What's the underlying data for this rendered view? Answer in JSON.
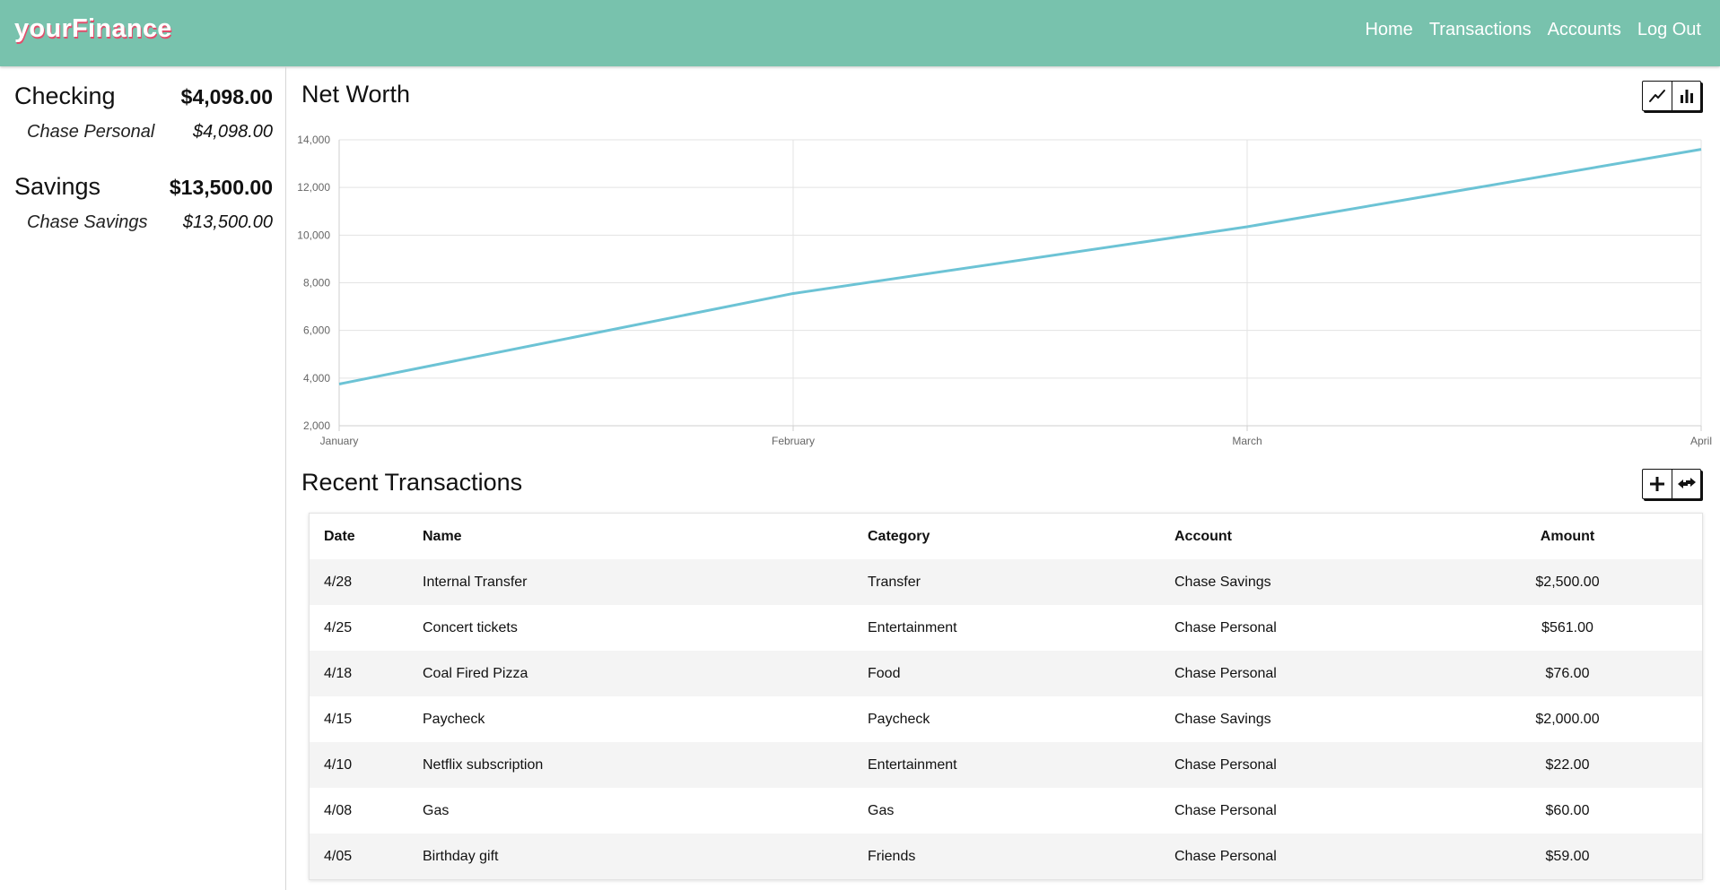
{
  "app": {
    "brand": "yourFinance"
  },
  "nav": {
    "items": [
      "Home",
      "Transactions",
      "Accounts",
      "Log Out"
    ]
  },
  "sidebar": {
    "groups": [
      {
        "name": "Checking",
        "total": "$4,098.00",
        "accounts": [
          {
            "name": "Chase Personal",
            "balance": "$4,098.00"
          }
        ]
      },
      {
        "name": "Savings",
        "total": "$13,500.00",
        "accounts": [
          {
            "name": "Chase Savings",
            "balance": "$13,500.00"
          }
        ]
      }
    ]
  },
  "net_worth": {
    "title": "Net Worth",
    "icons": {
      "line": "line-chart-icon",
      "bar": "bar-chart-icon"
    }
  },
  "chart_data": {
    "type": "line",
    "title": "",
    "xlabel": "",
    "ylabel": "",
    "categories": [
      "January",
      "February",
      "March",
      "April"
    ],
    "series": [
      {
        "values": [
          3750,
          7550,
          10350,
          13600
        ]
      }
    ],
    "ylim": [
      2000,
      14000
    ],
    "yticks": [
      "2,000",
      "4,000",
      "6,000",
      "8,000",
      "10,000",
      "12,000",
      "14,000"
    ],
    "grid": true,
    "line_color": "#6cc3d5"
  },
  "transactions": {
    "title": "Recent Transactions",
    "icons": {
      "add": "plus-icon",
      "transfer": "transfer-arrows-icon"
    },
    "columns": [
      "Date",
      "Name",
      "Category",
      "Account",
      "Amount"
    ],
    "rows": [
      [
        "4/28",
        "Internal Transfer",
        "Transfer",
        "Chase Savings",
        "$2,500.00"
      ],
      [
        "4/25",
        "Concert tickets",
        "Entertainment",
        "Chase Personal",
        "$561.00"
      ],
      [
        "4/18",
        "Coal Fired Pizza",
        "Food",
        "Chase Personal",
        "$76.00"
      ],
      [
        "4/15",
        "Paycheck",
        "Paycheck",
        "Chase Savings",
        "$2,000.00"
      ],
      [
        "4/10",
        "Netflix subscription",
        "Entertainment",
        "Chase Personal",
        "$22.00"
      ],
      [
        "4/08",
        "Gas",
        "Gas",
        "Chase Personal",
        "$60.00"
      ],
      [
        "4/05",
        "Birthday gift",
        "Friends",
        "Chase Personal",
        "$59.00"
      ]
    ]
  }
}
